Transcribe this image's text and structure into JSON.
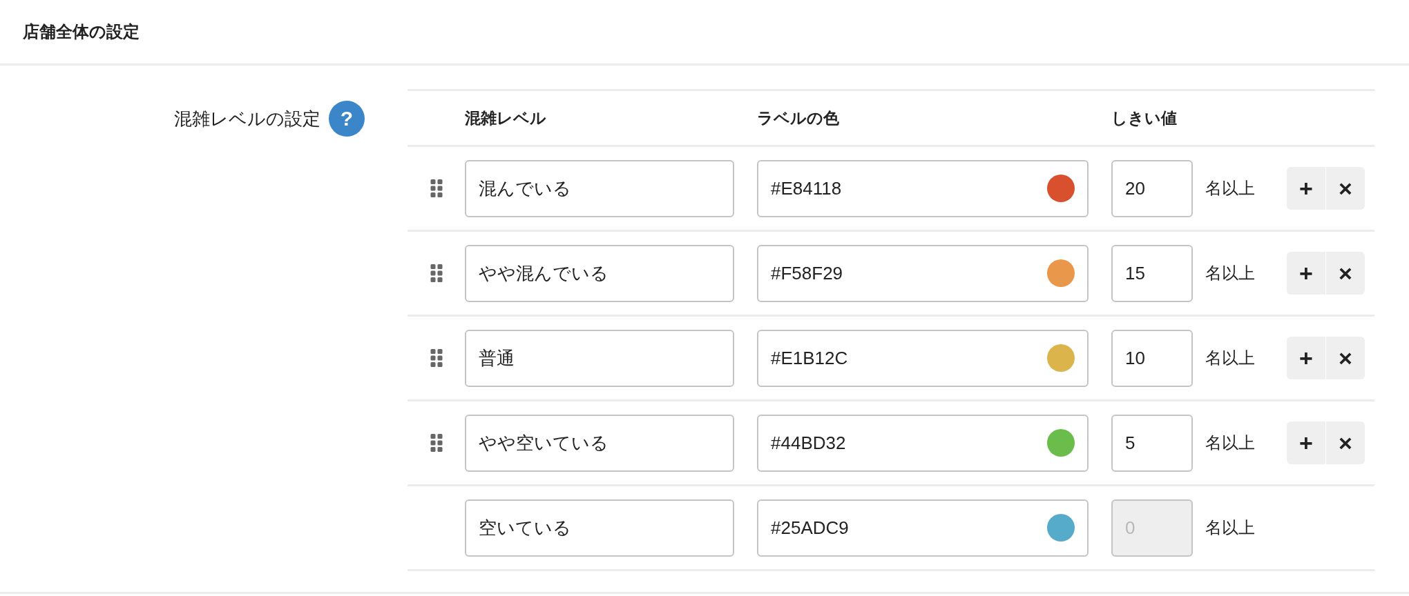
{
  "page": {
    "title": "店舗全体の設定"
  },
  "setting": {
    "label": "混雑レベルの設定",
    "help": "?"
  },
  "table": {
    "columns": [
      "混雑レベル",
      "ラベルの色",
      "しきい値"
    ],
    "rows": [
      {
        "draggable": true,
        "name": "混んでいる",
        "color_text": "#E84118",
        "color": "#d9502e",
        "threshold": {
          "value": "20",
          "disabled": false
        },
        "unit": "名以上",
        "buttons": [
          "+",
          "×"
        ]
      },
      {
        "draggable": true,
        "name": "やや混んでいる",
        "color_text": "#F58F29",
        "color": "#e9974a",
        "threshold": {
          "value": "15",
          "disabled": false
        },
        "unit": "名以上",
        "buttons": [
          "+",
          "×"
        ]
      },
      {
        "draggable": true,
        "name": "普通",
        "color_text": "#E1B12C",
        "color": "#dbb54c",
        "threshold": {
          "value": "10",
          "disabled": false
        },
        "unit": "名以上",
        "buttons": [
          "+",
          "×"
        ]
      },
      {
        "draggable": true,
        "name": "やや空いている",
        "color_text": "#44BD32",
        "color": "#6abd4b",
        "threshold": {
          "value": "5",
          "disabled": false
        },
        "unit": "名以上",
        "buttons": [
          "+",
          "×"
        ]
      },
      {
        "draggable": false,
        "name": "空いている",
        "color_text": "#25ADC9",
        "color": "#55abc9",
        "threshold": {
          "value": "0",
          "disabled": true
        },
        "unit": "名以上"
      }
    ]
  }
}
